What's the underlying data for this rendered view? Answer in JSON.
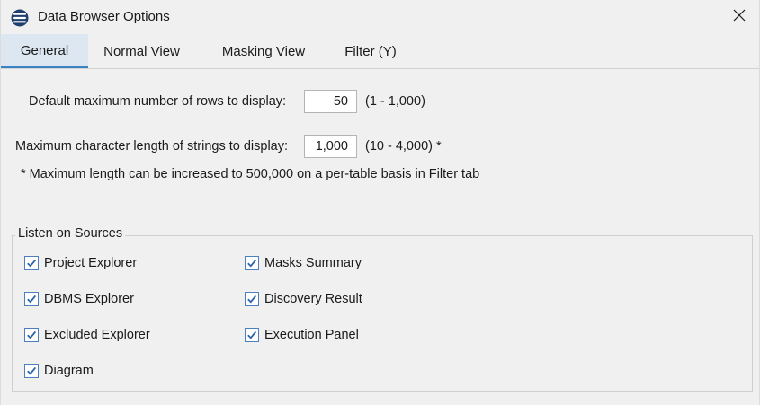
{
  "window": {
    "title": "Data Browser Options"
  },
  "tabs": [
    {
      "label": "General",
      "active": true
    },
    {
      "label": "Normal View",
      "active": false
    },
    {
      "label": "Masking View",
      "active": false
    },
    {
      "label": "Filter (Y)",
      "active": false
    }
  ],
  "general": {
    "max_rows": {
      "label": "Default maximum number of rows to display:",
      "value": "50",
      "range": "(1 - 1,000)"
    },
    "max_string_length": {
      "label": "Maximum character length of strings to display:",
      "value": "1,000",
      "range": "(10 - 4,000) *"
    },
    "footnote": "* Maximum length can be increased to 500,000 on a per-table basis in Filter tab"
  },
  "listen_on_sources": {
    "title": "Listen on Sources",
    "items": [
      {
        "label": "Project Explorer",
        "checked": true
      },
      {
        "label": "DBMS Explorer",
        "checked": true
      },
      {
        "label": "Excluded Explorer",
        "checked": true
      },
      {
        "label": "Diagram",
        "checked": true
      },
      {
        "label": "Masks Summary",
        "checked": true
      },
      {
        "label": "Discovery Result",
        "checked": true
      },
      {
        "label": "Execution Panel",
        "checked": true
      }
    ]
  },
  "icons": {
    "app": "database-stack-icon",
    "close": "close-icon",
    "check": "checkmark-icon"
  },
  "colors": {
    "active_tab_bg": "#dde7f2",
    "active_tab_underline": "#3b82c4",
    "checkbox_border": "#4a7fc0",
    "checkmark": "#2b63a8"
  }
}
